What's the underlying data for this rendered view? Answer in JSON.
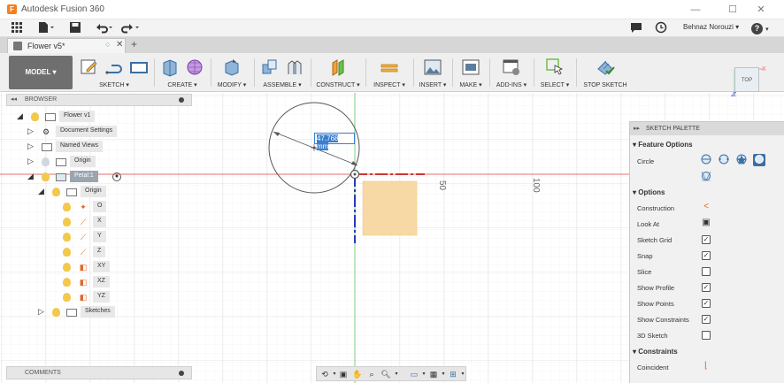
{
  "app": {
    "title": "Autodesk Fusion 360",
    "icon": "fusion-logo-icon"
  },
  "window_controls": {
    "minimize": "—",
    "maximize": "☐",
    "close": "✕"
  },
  "quick_access": {
    "user": "Behnaz Norouzi ▾",
    "help": "?"
  },
  "doc_tab": {
    "label": "Flower v5*",
    "state_icon": "○",
    "close": "✕"
  },
  "new_tab": "+",
  "toolbar": {
    "model": "MODEL ▾",
    "groups": [
      "SKETCH ▾",
      "CREATE ▾",
      "MODIFY ▾",
      "ASSEMBLE ▾",
      "CONSTRUCT ▾",
      "INSPECT ▾",
      "INSERT ▾",
      "MAKE ▾",
      "ADD-INS ▾",
      "SELECT ▾",
      "STOP SKETCH"
    ]
  },
  "browser": {
    "title": "BROWSER",
    "items": [
      {
        "label": "Flower v1"
      },
      {
        "label": "Document Settings"
      },
      {
        "label": "Named Views"
      },
      {
        "label": "Origin"
      },
      {
        "label": "Petal:1"
      },
      {
        "label": "Origin"
      },
      {
        "label": "O"
      },
      {
        "label": "X"
      },
      {
        "label": "Y"
      },
      {
        "label": "Z"
      },
      {
        "label": "XY"
      },
      {
        "label": "XZ"
      },
      {
        "label": "YZ"
      },
      {
        "label": "Sketches"
      }
    ]
  },
  "comments": {
    "title": "COMMENTS"
  },
  "viewport": {
    "dimension_value": "47.768 mm",
    "ruler_labels": [
      "50",
      "100"
    ],
    "viewcube_label": "TOP",
    "axis_x": "X",
    "axis_z": "Z"
  },
  "palette": {
    "title": "SKETCH PALETTE",
    "feature_options_header": "Feature Options",
    "circle_label": "Circle",
    "options_header": "Options",
    "options": [
      {
        "label": "Construction",
        "control": "icon",
        "checked": false
      },
      {
        "label": "Look At",
        "control": "icon",
        "checked": false
      },
      {
        "label": "Sketch Grid",
        "control": "checkbox",
        "checked": true
      },
      {
        "label": "Snap",
        "control": "checkbox",
        "checked": true
      },
      {
        "label": "Slice",
        "control": "checkbox",
        "checked": false
      },
      {
        "label": "Show Profile",
        "control": "checkbox",
        "checked": true
      },
      {
        "label": "Show Points",
        "control": "checkbox",
        "checked": true
      },
      {
        "label": "Show Constraints",
        "control": "checkbox",
        "checked": true
      },
      {
        "label": "3D Sketch",
        "control": "checkbox",
        "checked": false
      }
    ],
    "constraints_header": "Constraints",
    "constraints": [
      "Coincident"
    ]
  },
  "colors": {
    "accent": "#3a7fd0",
    "profile_fill": "#f7d9a6",
    "x_axis": "#e07070",
    "y_axis": "#7fcf7f",
    "construction_blue": "#2b3bb8",
    "construction_red": "#c93535"
  }
}
